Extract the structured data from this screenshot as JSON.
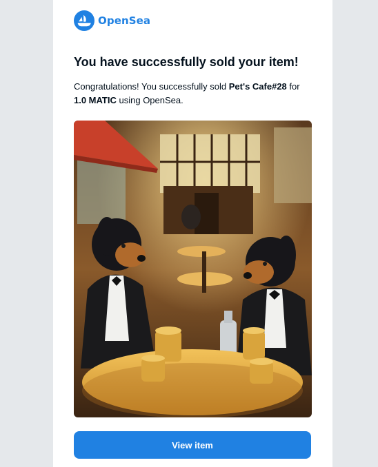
{
  "brand": {
    "name": "OpenSea",
    "logo_icon": "opensea-logo-icon",
    "color": "#2081e2"
  },
  "email": {
    "headline": "You have successfully sold your item!",
    "message": {
      "intro": "Congratulations! You successfully sold ",
      "item_name": "Pet's Cafe#28",
      "mid": " for",
      "price": "1.0 MATIC",
      "outro": " using OpenSea."
    },
    "image_description_icon": "nft-artwork-image",
    "cta_label": "View item"
  },
  "colors": {
    "page_background": "#e5e8eb",
    "card_background": "#ffffff",
    "text": "#04111d",
    "button": "#2081e2"
  }
}
